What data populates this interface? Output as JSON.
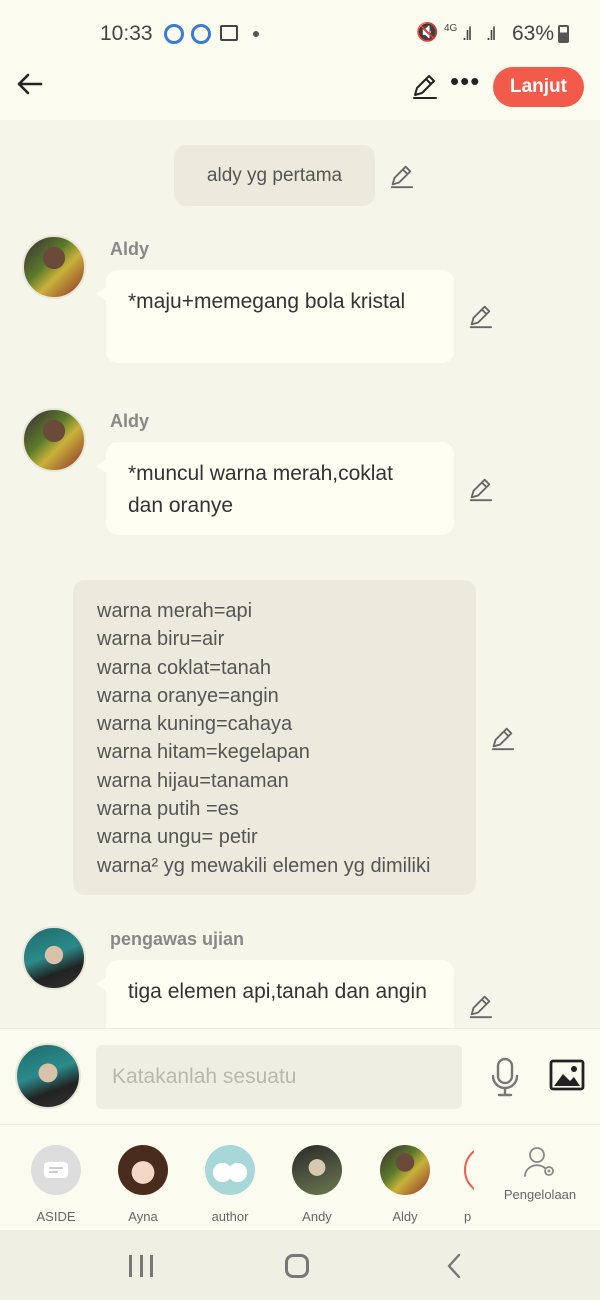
{
  "status_bar": {
    "time": "10:33",
    "network": "4G",
    "battery": "63%"
  },
  "top_bar": {
    "continue_label": "Lanjut",
    "more_label": "•••",
    "accent_color": "#f25a4a"
  },
  "chat": {
    "narration_1": "aldy yg pertama",
    "messages": [
      {
        "name": "Aldy",
        "text": "*maju+memegang bola kristal"
      },
      {
        "name": "Aldy",
        "text": "*muncul warna merah,coklat dan oranye"
      }
    ],
    "narration_2": [
      "warna merah=api",
      "warna biru=air",
      "warna coklat=tanah",
      "warna oranye=angin",
      "warna kuning=cahaya",
      "warna hitam=kegelapan",
      "warna hijau=tanaman",
      "warna putih =es",
      "warna ungu= petir",
      "warna² yg mewakili elemen yg dimiliki"
    ],
    "message_3": {
      "name": "pengawas ujian",
      "text": "tiga elemen api,tanah dan angin"
    }
  },
  "input": {
    "placeholder": "Katakanlah sesuatu"
  },
  "tabs": [
    {
      "label": "ASIDE"
    },
    {
      "label": "Ayna"
    },
    {
      "label": "author"
    },
    {
      "label": "Andy"
    },
    {
      "label": "Aldy"
    },
    {
      "label": "p"
    }
  ],
  "manage_label": "Pengelolaan"
}
